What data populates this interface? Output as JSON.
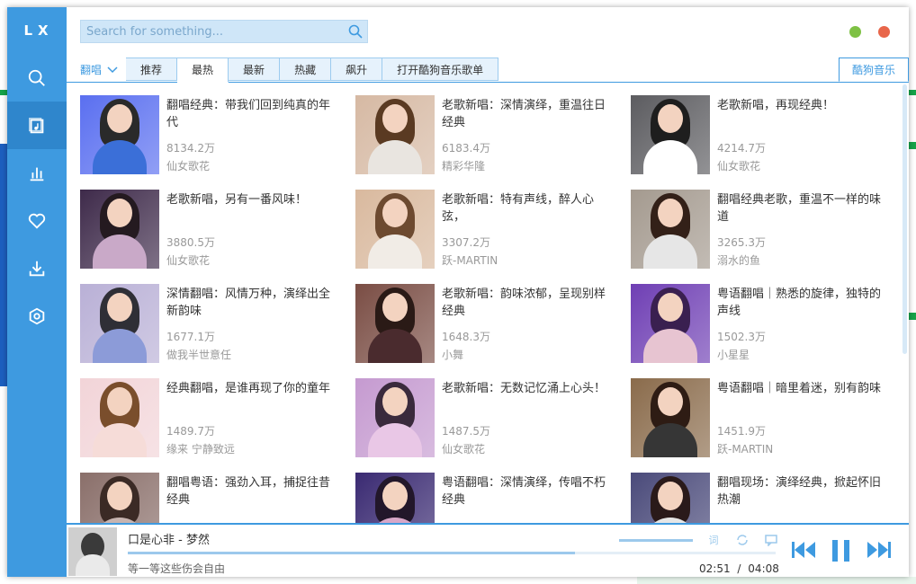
{
  "app": {
    "logo": "LX"
  },
  "search": {
    "placeholder": "Search for something..."
  },
  "tabs": {
    "sort_label": "翻唱",
    "items": [
      "推荐",
      "最热",
      "最新",
      "热藏",
      "飙升",
      "打开酷狗音乐歌单"
    ],
    "active_index": 1,
    "source": "酷狗音乐"
  },
  "playlists": [
    {
      "title": "翻唱经典：带我们回到纯真的年代",
      "plays": "8134.2万",
      "author": "仙女歌花",
      "hair": "#2a2a2a",
      "body": "#3b6fd8",
      "bg": "#5a6ff0"
    },
    {
      "title": "老歌新唱：深情演绎，重温往日经典",
      "plays": "6183.4万",
      "author": "精彩华隆",
      "hair": "#5a3a22",
      "body": "#e9e5e0",
      "bg": "#d6b9a3"
    },
    {
      "title": "老歌新唱，再现经典！",
      "plays": "4214.7万",
      "author": "仙女歌花",
      "hair": "#1e1e1e",
      "body": "#ffffff",
      "bg": "#5c5c60"
    },
    {
      "title": "老歌新唱，另有一番风味！",
      "plays": "3880.5万",
      "author": "仙女歌花",
      "hair": "#241a20",
      "body": "#c9a9c8",
      "bg": "#3e2a4a"
    },
    {
      "title": "老歌新唱：特有声线，醉人心弦，",
      "plays": "3307.2万",
      "author": "跃-MARTIN",
      "hair": "#6d4a30",
      "body": "#f1ece6",
      "bg": "#d9b99e"
    },
    {
      "title": "翻唱经典老歌，重温不一样的味道",
      "plays": "3265.3万",
      "author": "溺水的鱼",
      "hair": "#332018",
      "body": "#e6e6e6",
      "bg": "#a49a8f"
    },
    {
      "title": "深情翻唱：风情万种，演绎出全新韵味",
      "plays": "1677.1万",
      "author": "做我半世意任",
      "hair": "#2f2f36",
      "body": "#8c9bd8",
      "bg": "#b9b0d6"
    },
    {
      "title": "老歌新唱：韵味浓郁，呈现别样经典",
      "plays": "1648.3万",
      "author": "小舞",
      "hair": "#2a1a16",
      "body": "#4a2b2e",
      "bg": "#7a4d44"
    },
    {
      "title": "粤语翻唱｜熟悉的旋律，独特的声线",
      "plays": "1502.3万",
      "author": "小星星",
      "hair": "#3a2050",
      "body": "#e7c4d1",
      "bg": "#6f3fb4"
    },
    {
      "title": "经典翻唱，是谁再现了你的童年",
      "plays": "1489.7万",
      "author": "缘来 宁静致远",
      "hair": "#7a4e2c",
      "body": "#f6dcd8",
      "bg": "#f2d4d8"
    },
    {
      "title": "老歌新唱：无数记忆涌上心头！",
      "plays": "1487.5万",
      "author": "仙女歌花",
      "hair": "#3a2a3c",
      "body": "#e9c7e6",
      "bg": "#c59ad0"
    },
    {
      "title": "粤语翻唱｜暗里着迷，别有韵味",
      "plays": "1451.9万",
      "author": "跃-MARTIN",
      "hair": "#2e1c14",
      "body": "#363636",
      "bg": "#8a6b4b"
    },
    {
      "title": "翻唱粤语：强劲入耳，捕捉往昔经典",
      "plays": "",
      "author": "",
      "hair": "#3b2a25",
      "body": "#c7b4b0",
      "bg": "#8a6f6a"
    },
    {
      "title": "粤语翻唱：深情演绎，传唱不朽经典",
      "plays": "",
      "author": "",
      "hair": "#22172a",
      "body": "#d7a7c8",
      "bg": "#3a2a72"
    },
    {
      "title": "翻唱现场：演绎经典，掀起怀旧热潮",
      "plays": "",
      "author": "",
      "hair": "#2a1a1a",
      "body": "#e6e6e6",
      "bg": "#4a4a7a"
    }
  ],
  "player": {
    "song": "口是心非 - 梦然",
    "lyric": "等一等这些伤会自由",
    "current_time": "02:51",
    "separator": "/",
    "total_time": "04:08",
    "progress": 0.69,
    "volume": 1.0,
    "icon_lyric": "词"
  },
  "colors": {
    "accent": "#3e9ae0",
    "green_btn": "#7ec144",
    "red_btn": "#e8664a"
  }
}
